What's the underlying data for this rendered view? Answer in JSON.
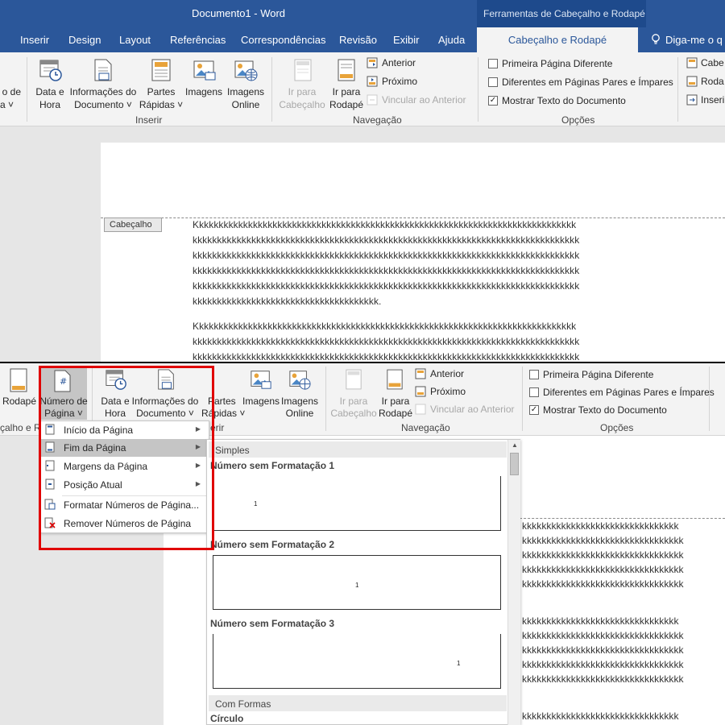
{
  "top": {
    "window_title": "Documento1  -  Word",
    "context_title": "Ferramentas de Cabeçalho e Rodapé",
    "tabs": [
      "Inserir",
      "Design",
      "Layout",
      "Referências",
      "Correspondências",
      "Revisão",
      "Exibir",
      "Ajuda"
    ],
    "active_tab": "Cabeçalho e Rodapé",
    "tell_me": "Diga-me o q",
    "ribbon": {
      "cut_left_label_1": "o de",
      "cut_left_label_2": "a ˅",
      "date_time_1": "Data e",
      "date_time_2": "Hora",
      "doc_info_1": "Informações do",
      "doc_info_2": "Documento ˅",
      "quick_parts_1": "Partes",
      "quick_parts_2": "Rápidas ˅",
      "images": "Imagens",
      "online_images_1": "Imagens",
      "online_images_2": "Online",
      "group_insert": "Inserir",
      "goto_header_1": "Ir para",
      "goto_header_2": "Cabeçalho",
      "goto_footer_1": "Ir para",
      "goto_footer_2": "Rodapé",
      "previous": "Anterior",
      "next": "Próximo",
      "link_previous": "Vincular ao Anterior",
      "group_navigation": "Navegação",
      "opt_first_page": "Primeira Página Diferente",
      "opt_odd_even": "Diferentes em Páginas Pares e Ímpares",
      "opt_show_text": "Mostrar Texto do Documento",
      "group_options": "Opções",
      "cut_right_1": "Cabe",
      "cut_right_2": "Roda",
      "cut_right_3": "Inseri"
    },
    "header_tag": "Cabeçalho",
    "lines": [
      "Kkkkkkkkkkkkkkkkkkkkkkkkkkkkkkkkkkkkkkkkkkkkkkkkkkkkkkkkkkkkkkkkkkkkkkkkkkkkkk",
      "kkkkkkkkkkkkkkkkkkkkkkkkkkkkkkkkkkkkkkkkkkkkkkkkkkkkkkkkkkkkkkkkkkkkkkkkkkkkkkk",
      "kkkkkkkkkkkkkkkkkkkkkkkkkkkkkkkkkkkkkkkkkkkkkkkkkkkkkkkkkkkkkkkkkkkkkkkkkkkkkkk",
      "kkkkkkkkkkkkkkkkkkkkkkkkkkkkkkkkkkkkkkkkkkkkkkkkkkkkkkkkkkkkkkkkkkkkkkkkkkkkkkk",
      "kkkkkkkkkkkkkkkkkkkkkkkkkkkkkkkkkkkkkkkkkkkkkkkkkkkkkkkkkkkkkkkkkkkkkkkkkkkkkkk",
      "kkkkkkkkkkkkkkkkkkkkkkkkkkkkkkkkkkkkkk.",
      "Kkkkkkkkkkkkkkkkkkkkkkkkkkkkkkkkkkkkkkkkkkkkkkkkkkkkkkkkkkkkkkkkkkkkkkkkkkkkkk",
      "kkkkkkkkkkkkkkkkkkkkkkkkkkkkkkkkkkkkkkkkkkkkkkkkkkkkkkkkkkkkkkkkkkkkkkkkkkkkkkk",
      "kkkkkkkkkkkkkkkkkkkkkkkkkkkkkkkkkkkkkkkkkkkkkkkkkkkkkkkkkkkkkkkkkkkkkkkkkkkkkkk"
    ]
  },
  "bottom": {
    "ribbon": {
      "footer": "Rodapé",
      "page_number_1": "Número de",
      "page_number_2": "Página ˅",
      "cut_group_label": "çalho e R",
      "date_time_1": "Data e",
      "date_time_2": "Hora",
      "doc_info_1": "Informações do",
      "doc_info_2": "Documento ˅",
      "quick_parts_1": "Partes",
      "quick_parts_2": "Rápidas ˅",
      "images": "Imagens",
      "online_images_1": "Imagens",
      "online_images_2": "Online",
      "group_insert_cut": "erir",
      "goto_header_1": "Ir para",
      "goto_header_2": "Cabeçalho",
      "goto_footer_1": "Ir para",
      "goto_footer_2": "Rodapé",
      "previous": "Anterior",
      "next": "Próximo",
      "link_previous": "Vincular ao Anterior",
      "group_navigation": "Navegação",
      "opt_first_page": "Primeira Página Diferente",
      "opt_odd_even": "Diferentes em Páginas Pares e Ímpares",
      "opt_show_text": "Mostrar Texto do Documento",
      "group_options": "Opções"
    },
    "menu": {
      "items": [
        "Início da Página",
        "Fim da Página",
        "Margens da Página",
        "Posição Atual",
        "Formatar Números de Página...",
        "Remover Números de Página"
      ]
    },
    "gallery": {
      "section_simple": "Simples",
      "item1": "Número sem Formatação 1",
      "item2": "Número sem Formatação 2",
      "item3": "Número sem Formatação 3",
      "sample_number": "1",
      "section_shapes": "Com Formas",
      "item4": "Círculo"
    },
    "lines": [
      "kkkkkkkkkkkkkkkkkkkkkkkkkkkkkkkk",
      "kkkkkkkkkkkkkkkkkkkkkkkkkkkkkkkkk",
      "kkkkkkkkkkkkkkkkkkkkkkkkkkkkkkkkk",
      "kkkkkkkkkkkkkkkkkkkkkkkkkkkkkkkkk",
      "kkkkkkkkkkkkkkkkkkkkkkkkkkkkkkkkk",
      "kkkkkkkkkkkkkkkkkkkkkkkkkkkkkkkk",
      "kkkkkkkkkkkkkkkkkkkkkkkkkkkkkkkkk",
      "kkkkkkkkkkkkkkkkkkkkkkkkkkkkkkkkk",
      "kkkkkkkkkkkkkkkkkkkkkkkkkkkkkkkkk",
      "kkkkkkkkkkkkkkkkkkkkkkkkkkkkkkkkk",
      "kkkkkkkkkkkkkkkkkkkkkkkkkkkkkkkk"
    ]
  },
  "colors": {
    "word_blue": "#2b579a",
    "ribbon_bg": "#f3f3f3",
    "highlight_red": "#e00000"
  }
}
